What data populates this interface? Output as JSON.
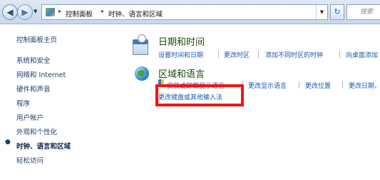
{
  "address_bar": {
    "breadcrumbs": [
      "控制面板",
      "时钟、语言和区域"
    ],
    "search_placeholder": "搜索"
  },
  "sidebar": {
    "items": [
      {
        "label": "控制面板主页",
        "current": false
      },
      {
        "label": "系统和安全",
        "current": false
      },
      {
        "label": "网络和 Internet",
        "current": false
      },
      {
        "label": "硬件和声音",
        "current": false
      },
      {
        "label": "程序",
        "current": false
      },
      {
        "label": "用户帐户",
        "current": false
      },
      {
        "label": "外观和个性化",
        "current": false
      },
      {
        "label": "时钟、语言和区域",
        "current": true
      },
      {
        "label": "轻松访问",
        "current": false
      }
    ]
  },
  "categories": [
    {
      "title": "日期和时间",
      "icon": "calendar-clock-icon",
      "links": [
        "设置时间和日期",
        "更改时区",
        "添加不同时区的时钟",
        "向桌面添加"
      ]
    },
    {
      "title": "区域和语言",
      "icon": "globe-icon",
      "links": [
        "安装或卸载显示语言",
        "更改显示语言",
        "更改位置",
        "更改日期、"
      ],
      "extra_link": "更改键盘或其他输入法"
    }
  ],
  "annotation": {
    "color": "#f01616"
  }
}
